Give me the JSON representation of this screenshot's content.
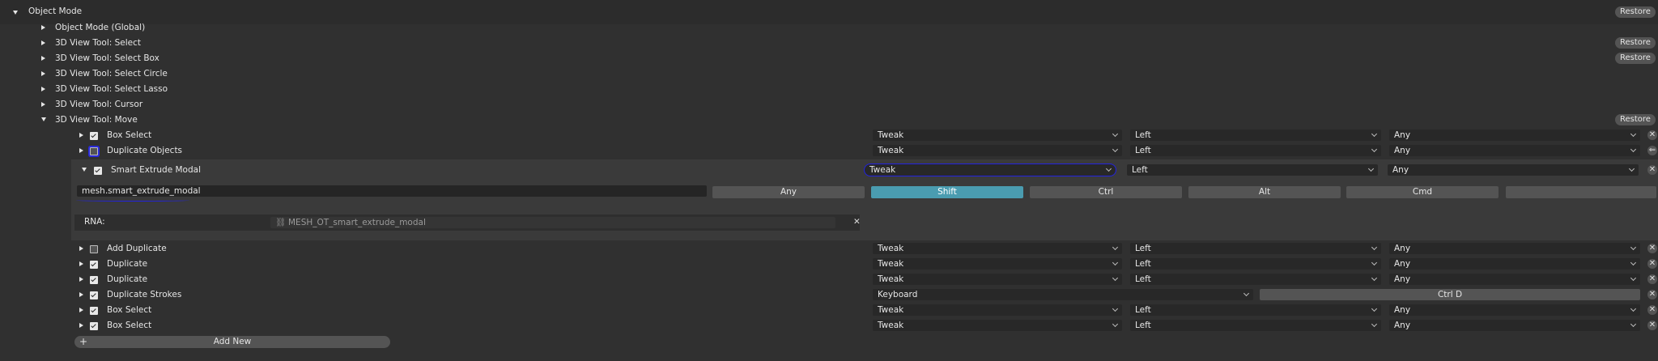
{
  "header": {
    "object_mode": "Object Mode",
    "restore": "Restore"
  },
  "groups": [
    {
      "label": "Object Mode (Global)",
      "restore": ""
    },
    {
      "label": "3D View Tool: Select",
      "restore": "Restore"
    },
    {
      "label": "3D View Tool: Select Box",
      "restore": "Restore"
    },
    {
      "label": "3D View Tool: Select Circle",
      "restore": ""
    },
    {
      "label": "3D View Tool: Select Lasso",
      "restore": ""
    },
    {
      "label": "3D View Tool: Cursor",
      "restore": ""
    },
    {
      "label": "3D View Tool: Move",
      "restore": "Restore"
    }
  ],
  "items": [
    {
      "name": "Box Select",
      "checked": true,
      "type": "Tweak",
      "button": "Left",
      "modifier": "Any"
    },
    {
      "name": "Duplicate Objects",
      "checked": false,
      "type": "Tweak",
      "button": "Left",
      "modifier": "Any"
    }
  ],
  "expanded": {
    "name": "Smart Extrude Modal",
    "checked": true,
    "type": "Tweak",
    "button": "Left",
    "modifier": "Any",
    "operator_id": "mesh.smart_extrude_modal",
    "modifiers": [
      "Any",
      "Shift",
      "Ctrl",
      "Alt",
      "Cmd",
      ""
    ],
    "active_modifier": "Shift",
    "rna_label": "RNA:",
    "rna_value": "MESH_OT_smart_extrude_modal"
  },
  "items2": [
    {
      "name": "Add Duplicate",
      "checked": false,
      "type": "Tweak",
      "button": "Left",
      "modifier": "Any"
    },
    {
      "name": "Duplicate",
      "checked": true,
      "type": "Tweak",
      "button": "Left",
      "modifier": "Any"
    },
    {
      "name": "Duplicate",
      "checked": true,
      "type": "Tweak",
      "button": "Left",
      "modifier": "Any"
    },
    {
      "name": "Duplicate Strokes",
      "checked": true,
      "type": "Keyboard",
      "key": "Ctrl D"
    },
    {
      "name": "Box Select",
      "checked": true,
      "type": "Tweak",
      "button": "Left",
      "modifier": "Any"
    },
    {
      "name": "Box Select",
      "checked": true,
      "type": "Tweak",
      "button": "Left",
      "modifier": "Any"
    }
  ],
  "add_new": "Add New",
  "colors": {
    "background": "#303030",
    "panel": "#3a3a3a",
    "active": "#4a9cb0",
    "annotation": "#1f1fe6"
  }
}
